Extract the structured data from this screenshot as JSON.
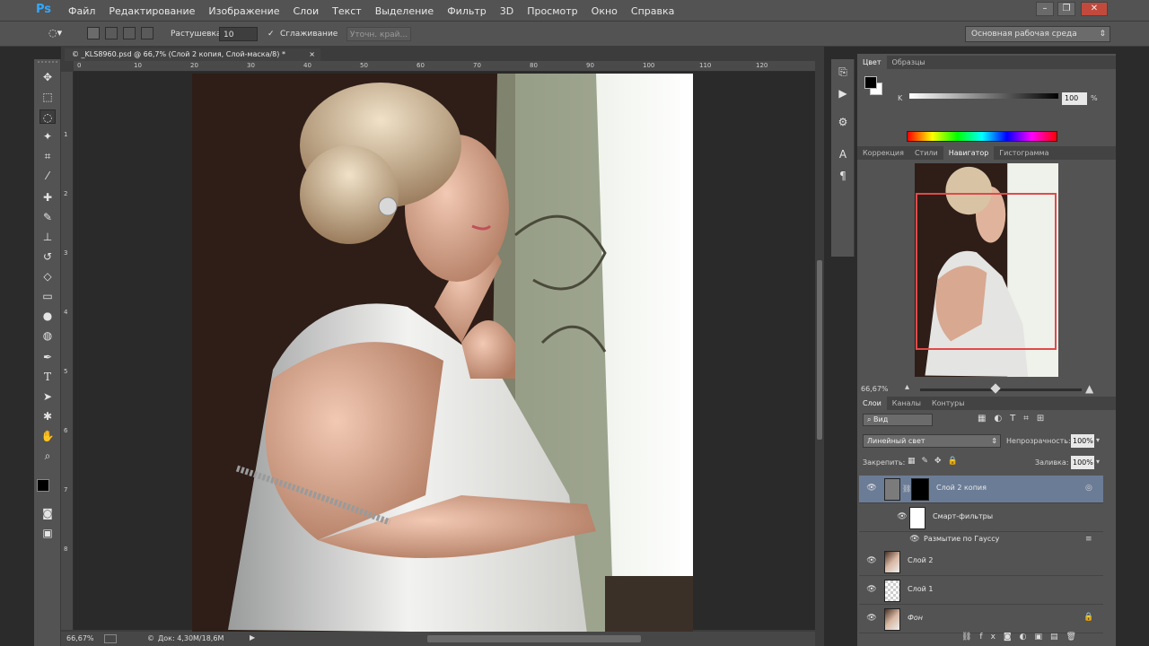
{
  "app": {
    "logo": "Ps"
  },
  "menu": [
    "Файл",
    "Редактирование",
    "Изображение",
    "Слои",
    "Текст",
    "Выделение",
    "Фильтр",
    "3D",
    "Просмотр",
    "Окно",
    "Справка"
  ],
  "window_controls": {
    "minimize": "–",
    "restore": "❐",
    "close": "✕"
  },
  "options": {
    "feather_label": "Растушевка:",
    "feather_value": "10 пикс.",
    "antialias_label": "Сглаживание",
    "antialias_checked": true,
    "refine_edge": "Уточн. край...",
    "workspace": "Основная рабочая среда"
  },
  "document": {
    "tab_title": "© _KLS8960.psd @ 66,7% (Слой 2 копия, Слой-маска/8) *",
    "close": "×",
    "ruler_h": [
      "0",
      "10",
      "20",
      "30",
      "40",
      "50",
      "60",
      "70",
      "80",
      "90",
      "100",
      "110",
      "120"
    ],
    "ruler_v": [
      "1",
      "2",
      "3",
      "4",
      "5",
      "6",
      "7",
      "8"
    ],
    "zoom": "66,67%",
    "doc_size": "Док: 4,30М/18,6М"
  },
  "tools": [
    "move-tool",
    "marquee-tool",
    "lasso-tool",
    "magic-wand-tool",
    "crop-tool",
    "eyedropper-tool",
    "healing-brush-tool",
    "brush-tool",
    "clone-stamp-tool",
    "history-brush-tool",
    "eraser-tool",
    "gradient-tool",
    "blur-tool",
    "dodge-tool",
    "pen-tool",
    "type-tool",
    "path-selection-tool",
    "shape-tool",
    "hand-tool",
    "zoom-tool"
  ],
  "color_panel": {
    "tabs": [
      "Цвет",
      "Образцы"
    ],
    "channel_label": "K",
    "value": "100",
    "unit": "%",
    "foreground": "#000000",
    "background": "#ffffff"
  },
  "navigator_panel": {
    "tabs": [
      "Коррекция",
      "Стили",
      "Навигатор",
      "Гистограмма"
    ],
    "active_tab": "Навигатор",
    "zoom": "66,67%",
    "zoom_level": 0.42
  },
  "layers_panel": {
    "tabs": [
      "Слои",
      "Каналы",
      "Контуры"
    ],
    "filter_kind": "Вид",
    "blend_mode": "Линейный свет",
    "opacity_label": "Непрозрачность:",
    "opacity_value": "100%",
    "lock_label": "Закрепить:",
    "fill_label": "Заливка:",
    "fill_value": "100%",
    "layers": [
      {
        "name": "Слой 2 копия",
        "selected": true
      },
      {
        "name": "Смарт-фильтры",
        "selected": false
      },
      {
        "name": "Размытие по Гауссу",
        "selected": false
      },
      {
        "name": "Слой 2",
        "selected": false
      },
      {
        "name": "Слой 1",
        "selected": false
      },
      {
        "name": "Фон",
        "selected": false
      }
    ]
  },
  "colors": {
    "ui_dark": "#535353",
    "ui_darker": "#434343",
    "selection": "#6b7c96",
    "nav_frame": "#e04a4a"
  }
}
